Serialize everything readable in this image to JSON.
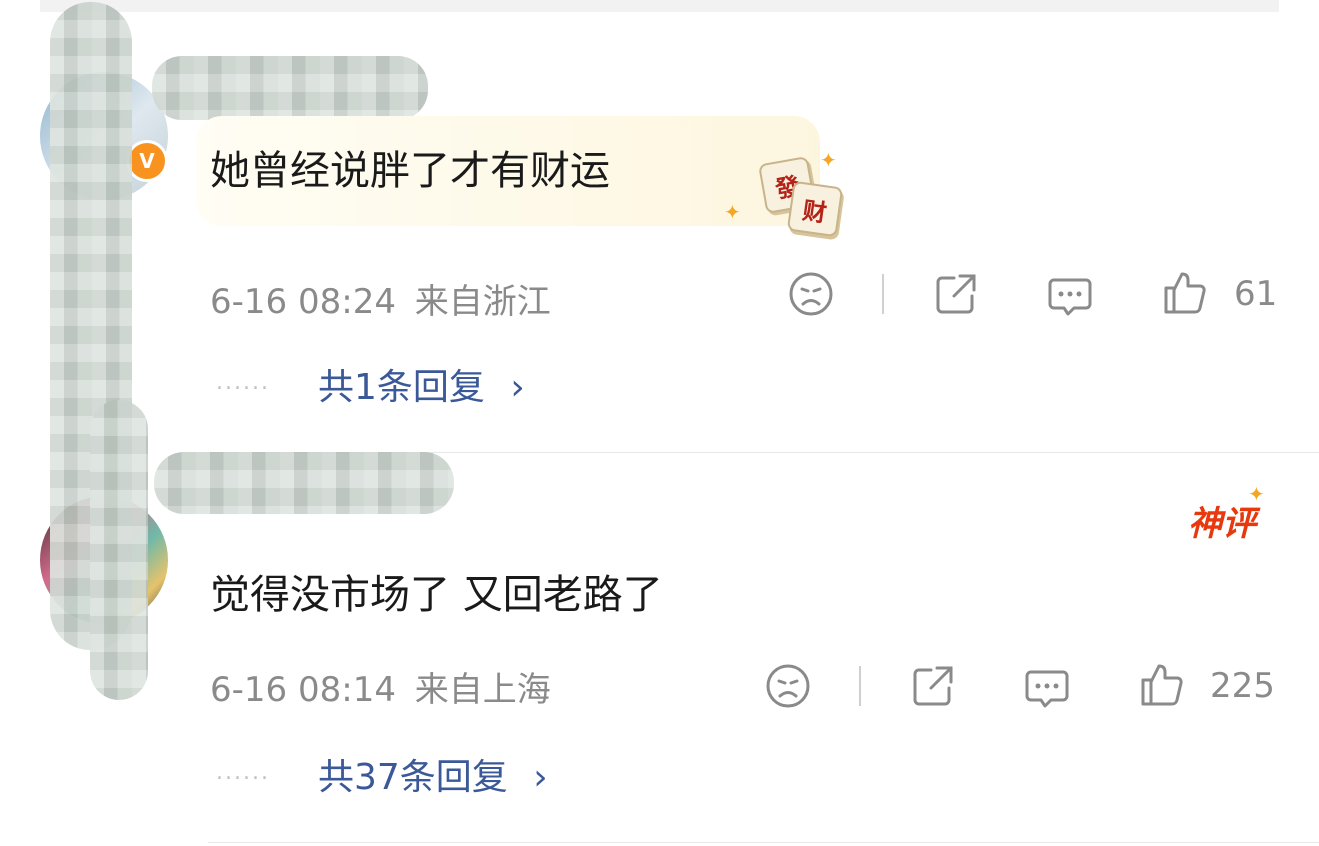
{
  "comments": [
    {
      "text": "她曾经说胖了才有财运",
      "time": "6-16 08:24",
      "location": "来自浙江",
      "likes": "61",
      "replies": "共1条回复",
      "verified_badge": "V",
      "sticker": [
        "發",
        "财"
      ]
    },
    {
      "text": "觉得没市场了 又回老路了",
      "time": "6-16 08:14",
      "location": "来自上海",
      "likes": "225",
      "replies": "共37条回复",
      "badge": "神评"
    }
  ],
  "ui": {
    "dots": "......",
    "chevron": "›",
    "icons": [
      "dislike-face-icon",
      "share-icon",
      "comment-icon",
      "like-thumb-icon"
    ],
    "colors": {
      "reply_link": "#3b5998",
      "meta": "#8a8a8a",
      "badge": "#e8380d",
      "vip": "#f7931e"
    }
  }
}
